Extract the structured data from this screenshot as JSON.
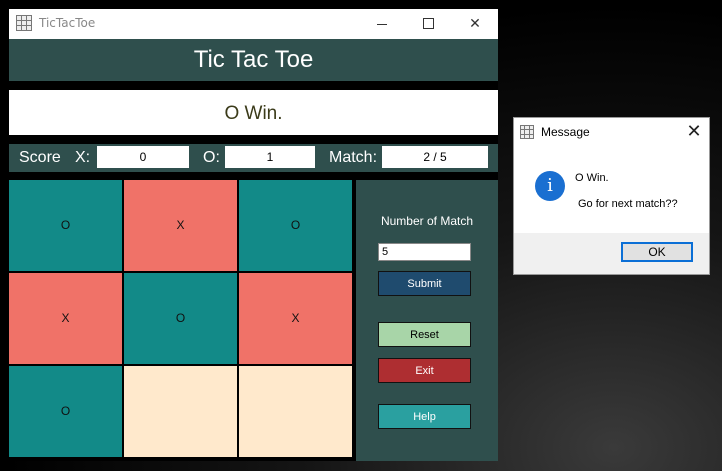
{
  "window": {
    "title": "TicTacToe",
    "minimize_icon": "minimize-icon",
    "maximize_icon": "maximize-icon",
    "close_symbol": "✕"
  },
  "header": {
    "title": "Tic Tac Toe"
  },
  "status": {
    "text": "O Win."
  },
  "score": {
    "label": "Score",
    "x_label": "X:",
    "x_value": "0",
    "o_label": "O:",
    "o_value": "1",
    "match_label": "Match:",
    "match_value": "2 / 5"
  },
  "board": {
    "cells": [
      "O",
      "X",
      "O",
      "X",
      "O",
      "X",
      "O",
      "",
      ""
    ],
    "cell_colors": {
      "O": "#128a88",
      "X": "#f07268",
      "empty": "#ffe9cc"
    }
  },
  "side_panel": {
    "number_of_match_label": "Number of Match",
    "number_of_match_value": "5",
    "submit_label": "Submit",
    "reset_label": "Reset",
    "exit_label": "Exit",
    "help_label": "Help"
  },
  "dialog": {
    "title": "Message",
    "close_symbol": "✕",
    "icon": "info-icon",
    "icon_glyph": "i",
    "line1": "O Win.",
    "line2": "Go for next match??",
    "ok_label": "OK"
  },
  "colors": {
    "panel": "#2f4f4d",
    "submit": "#1f4b6e",
    "reset": "#a8d5a8",
    "exit": "#ae2e31",
    "help": "#2aa0a0"
  }
}
